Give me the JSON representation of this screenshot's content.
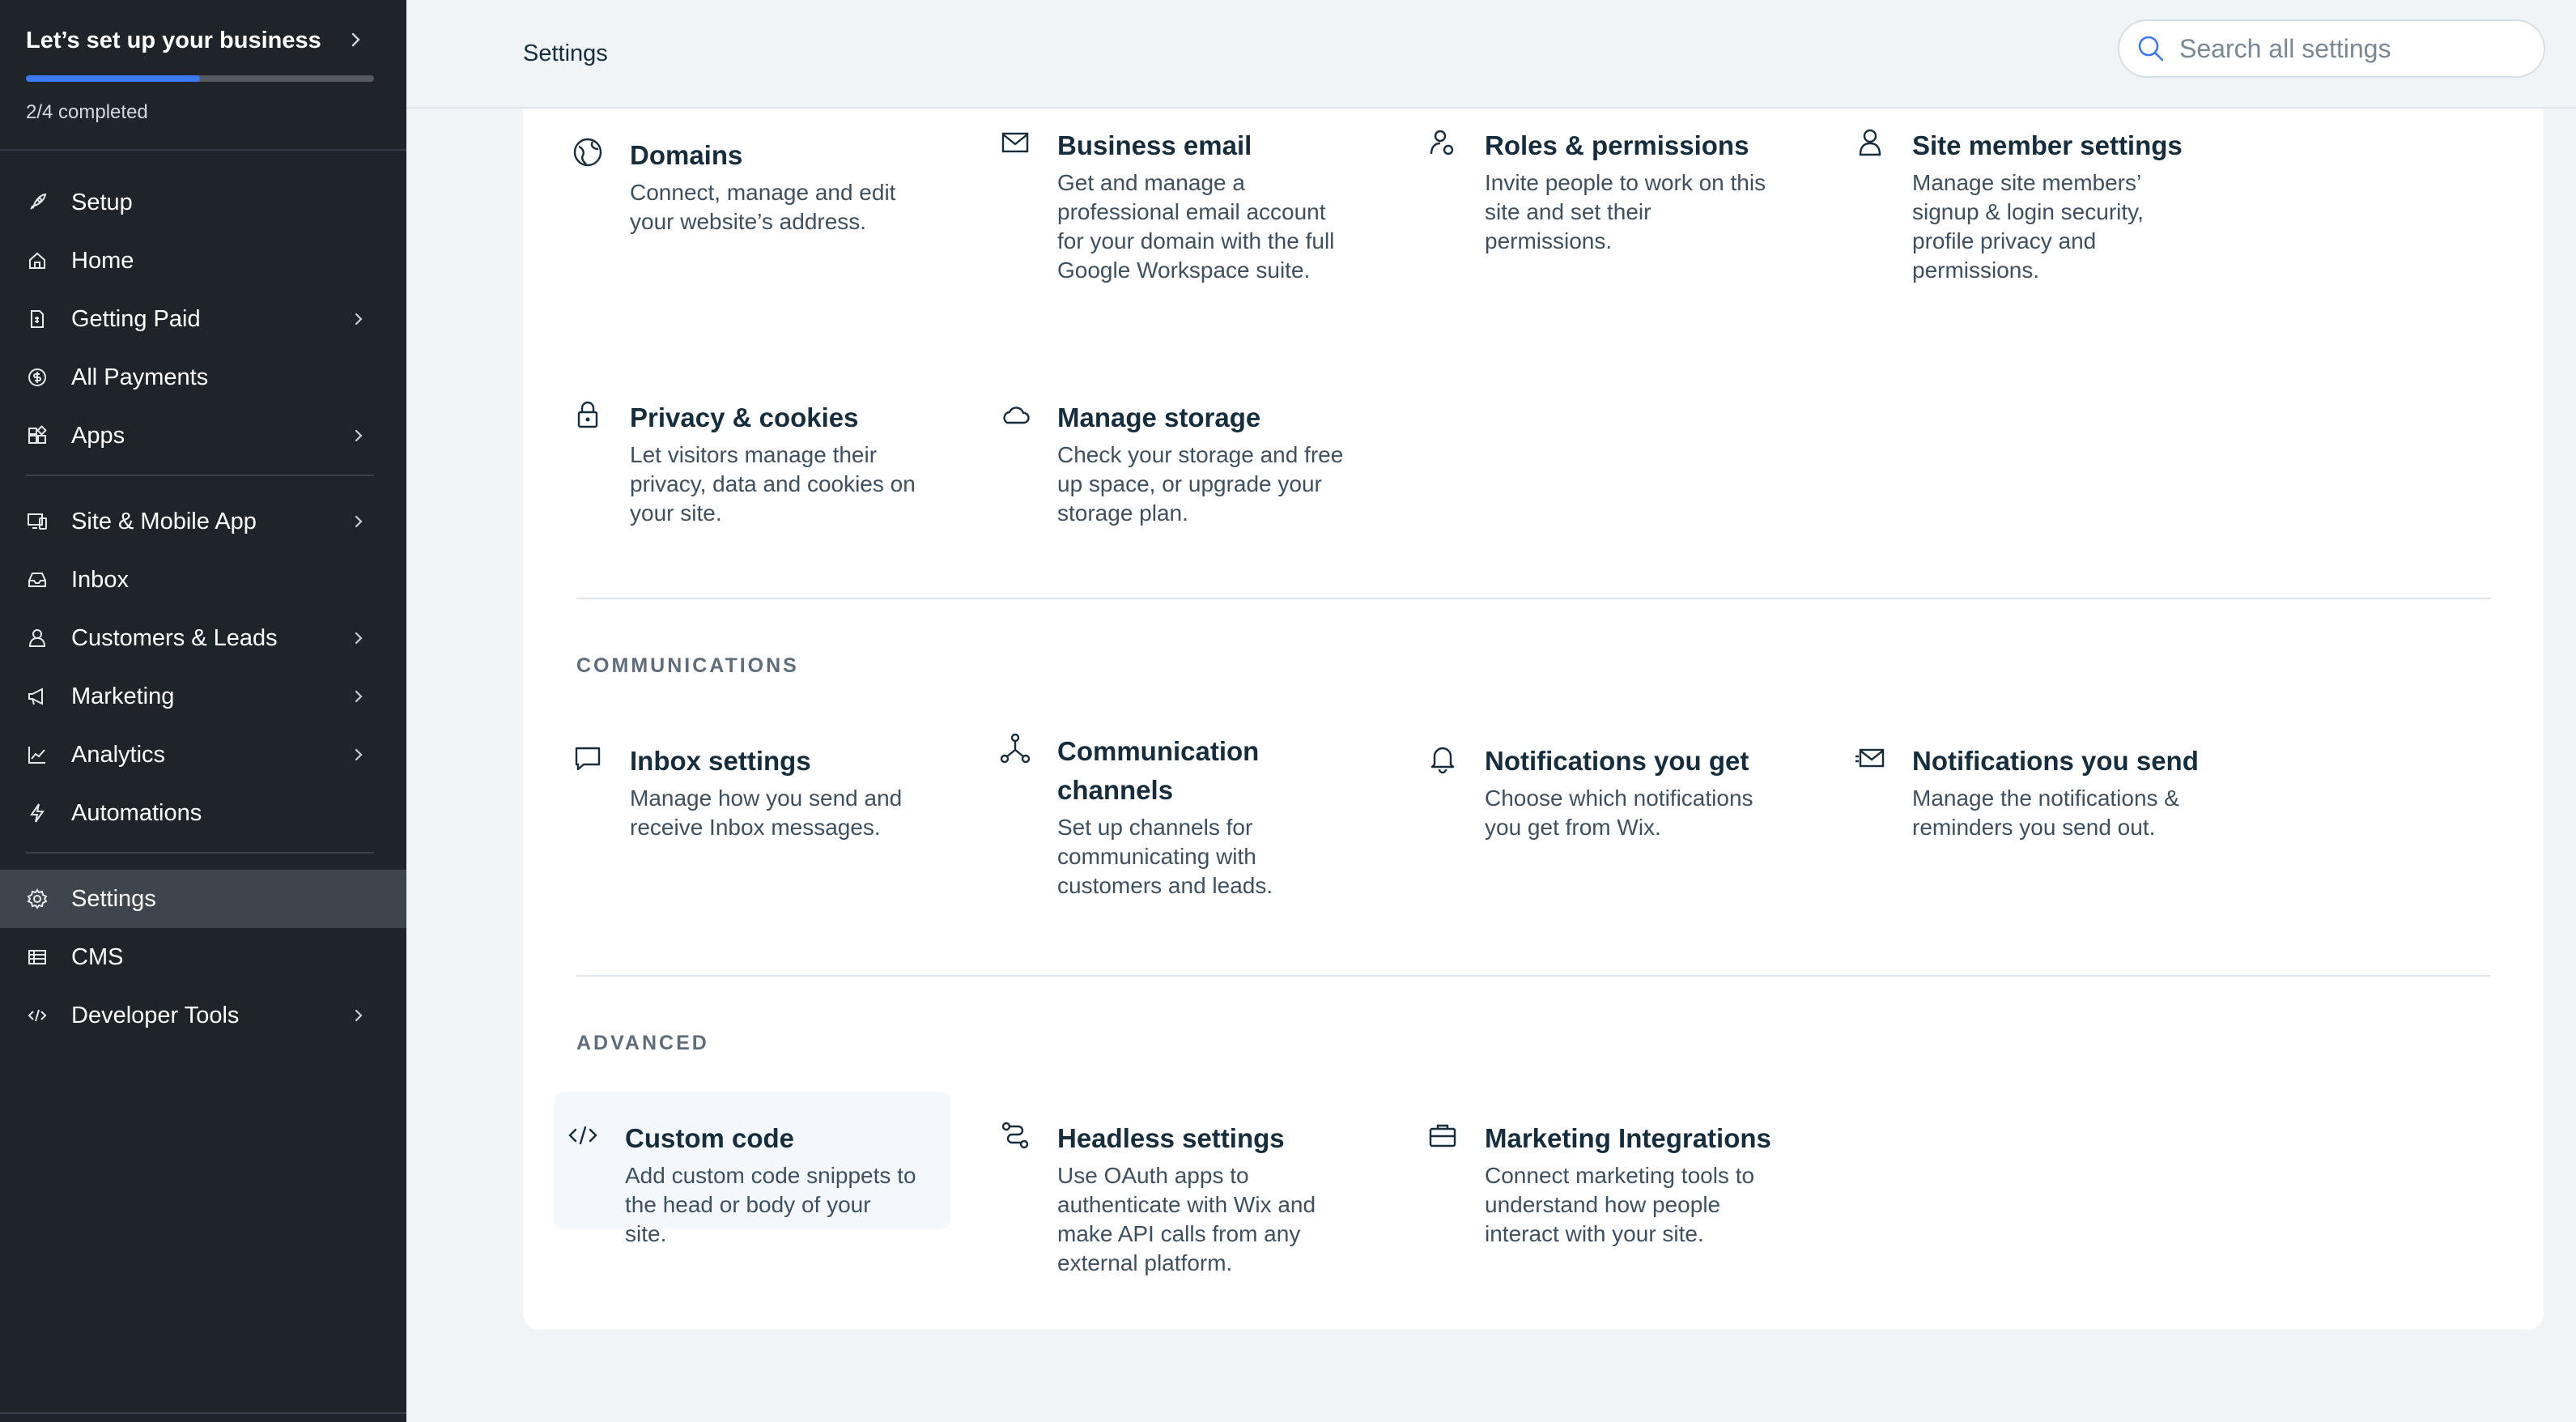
{
  "setup": {
    "title": "Let’s set up your business",
    "progress_text": "2/4 completed",
    "progress_fraction": 0.5
  },
  "nav": {
    "groups": [
      [
        {
          "label": "Setup",
          "icon": "rocket-icon",
          "chevron": false
        },
        {
          "label": "Home",
          "icon": "home-icon",
          "chevron": false
        },
        {
          "label": "Getting Paid",
          "icon": "invoice-icon",
          "chevron": true
        },
        {
          "label": "All Payments",
          "icon": "dollar-icon",
          "chevron": false
        },
        {
          "label": "Apps",
          "icon": "apps-icon",
          "chevron": true
        }
      ],
      [
        {
          "label": "Site & Mobile App",
          "icon": "devices-icon",
          "chevron": true
        },
        {
          "label": "Inbox",
          "icon": "inbox-icon",
          "chevron": false
        },
        {
          "label": "Customers & Leads",
          "icon": "customers-icon",
          "chevron": true
        },
        {
          "label": "Marketing",
          "icon": "megaphone-icon",
          "chevron": true
        },
        {
          "label": "Analytics",
          "icon": "analytics-icon",
          "chevron": true
        },
        {
          "label": "Automations",
          "icon": "lightning-icon",
          "chevron": false
        }
      ],
      [
        {
          "label": "Settings",
          "icon": "gear-icon",
          "chevron": false,
          "active": true
        },
        {
          "label": "CMS",
          "icon": "table-icon",
          "chevron": false
        },
        {
          "label": "Developer Tools",
          "icon": "code-icon",
          "chevron": true
        }
      ]
    ]
  },
  "header": {
    "title": "Settings",
    "search_placeholder": "Search all settings"
  },
  "sections": {
    "communications": "COMMUNICATIONS",
    "advanced": "ADVANCED"
  },
  "tiles": {
    "domains": {
      "title": "Domains",
      "desc": "Connect, manage and edit your website’s address.",
      "icon": "globe-icon"
    },
    "business_email": {
      "title": "Business email",
      "desc": "Get and manage a professional email account for your domain with the full Google Workspace suite.",
      "icon": "envelope-icon"
    },
    "roles": {
      "title": "Roles & permissions",
      "desc": "Invite people to work on this site and set their permissions.",
      "icon": "user-key-icon"
    },
    "site_member": {
      "title": "Site member settings",
      "desc": "Manage site members’ signup & login security, profile privacy and permissions.",
      "icon": "person-icon"
    },
    "privacy": {
      "title": "Privacy & cookies",
      "desc": "Let visitors manage their privacy, data and cookies on your site.",
      "icon": "lock-icon"
    },
    "storage": {
      "title": "Manage storage",
      "desc": "Check your storage and free up space, or upgrade your storage plan.",
      "icon": "cloud-icon"
    },
    "inbox_settings": {
      "title": "Inbox settings",
      "desc": "Manage how you send and receive Inbox messages.",
      "icon": "chat-icon"
    },
    "channels": {
      "title": "Communication channels",
      "desc": "Set up channels for communicating with customers and leads.",
      "icon": "nodes-icon"
    },
    "notif_get": {
      "title": "Notifications you get",
      "desc": "Choose which notifications you get from Wix.",
      "icon": "bell-icon"
    },
    "notif_send": {
      "title": "Notifications you send",
      "desc": "Manage the notifications & reminders you send out.",
      "icon": "send-mail-icon"
    },
    "custom_code": {
      "title": "Custom code",
      "desc": "Add custom code snippets to the head or body of your site.",
      "icon": "code-icon"
    },
    "headless": {
      "title": "Headless settings",
      "desc": "Use OAuth apps to authenticate with Wix and make API calls from any external platform.",
      "icon": "route-icon"
    },
    "marketing_int": {
      "title": "Marketing Integrations",
      "desc": "Connect marketing tools to understand how people interact with your site.",
      "icon": "briefcase-icon"
    }
  }
}
